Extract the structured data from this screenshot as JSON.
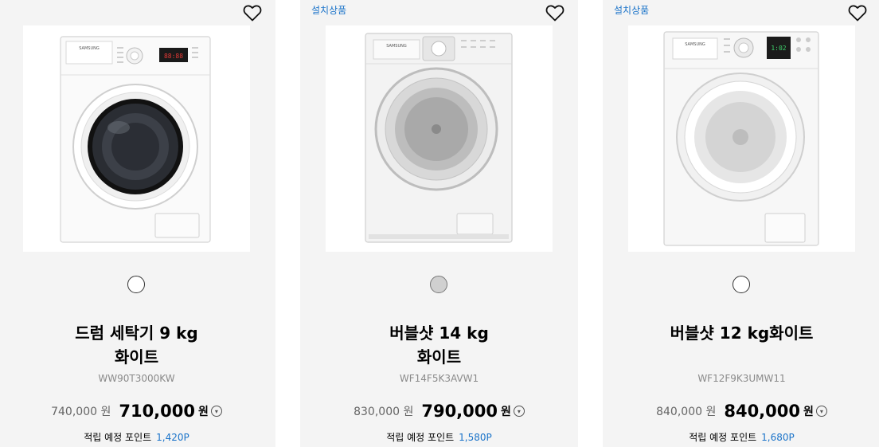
{
  "products": [
    {
      "badge": "",
      "name_line1": "드럼 세탁기 9 kg",
      "name_line2": "화이트",
      "model": "WW90T3000KW",
      "swatch_color": "#ffffff",
      "original_price": "740,000 원",
      "sale_price": "710,000",
      "currency": "원",
      "points_label": "적립 예정 포인트",
      "points_value": "1,420P",
      "brand_label": "SAMSUNG",
      "display_text": "88:88"
    },
    {
      "badge": "설치상품",
      "name_line1": "버블샷 14 kg",
      "name_line2": "화이트",
      "model": "WF14F5K3AVW1",
      "swatch_color": "#d0d0d0",
      "original_price": "830,000 원",
      "sale_price": "790,000",
      "currency": "원",
      "points_label": "적립 예정 포인트",
      "points_value": "1,580P",
      "brand_label": "SAMSUNG",
      "display_text": ""
    },
    {
      "badge": "설치상품",
      "name_line1": "버블샷 12 kg화이트",
      "name_line2": "",
      "model": "WF12F9K3UMW11",
      "swatch_color": "#ffffff",
      "original_price": "840,000 원",
      "sale_price": "840,000",
      "currency": "원",
      "points_label": "적립 예정 포인트",
      "points_value": "1,680P",
      "brand_label": "SAMSUNG",
      "display_text": "1:02"
    }
  ],
  "colors": {
    "card_bg": "#f4f4f4",
    "badge": "#1a73c9",
    "points": "#1a73c9"
  },
  "icons": {
    "wishlist": "heart-outline-icon",
    "price_info": "chevron-down-circle-icon"
  }
}
